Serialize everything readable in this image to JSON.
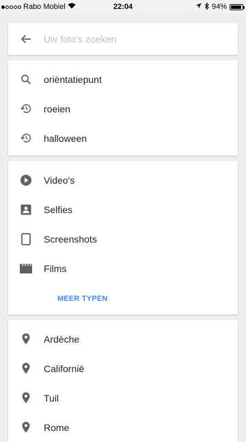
{
  "status_bar": {
    "carrier": "Rabo Mobiel",
    "time": "22:04",
    "battery": "94%",
    "battery_level": 0.94
  },
  "search": {
    "placeholder": "Uw foto's zoeken",
    "value": ""
  },
  "suggestions": [
    {
      "icon": "search-icon",
      "label": "oriëntatiepunt"
    },
    {
      "icon": "history-icon",
      "label": "roeien"
    },
    {
      "icon": "history-icon",
      "label": "halloween"
    }
  ],
  "types": {
    "items": [
      {
        "icon": "video-icon",
        "label": "Video's"
      },
      {
        "icon": "selfie-icon",
        "label": "Selfies"
      },
      {
        "icon": "screenshot-icon",
        "label": "Screenshots"
      },
      {
        "icon": "film-icon",
        "label": "Films"
      }
    ],
    "more_label": "MEER TYPEN"
  },
  "places": [
    {
      "icon": "place-icon",
      "label": "Ardèche"
    },
    {
      "icon": "place-icon",
      "label": "Californië"
    },
    {
      "icon": "place-icon",
      "label": "Tuil"
    },
    {
      "icon": "place-icon",
      "label": "Rome"
    }
  ],
  "colors": {
    "accent": "#4285f4",
    "icon_gray": "#616161",
    "background": "#eeeeee"
  }
}
